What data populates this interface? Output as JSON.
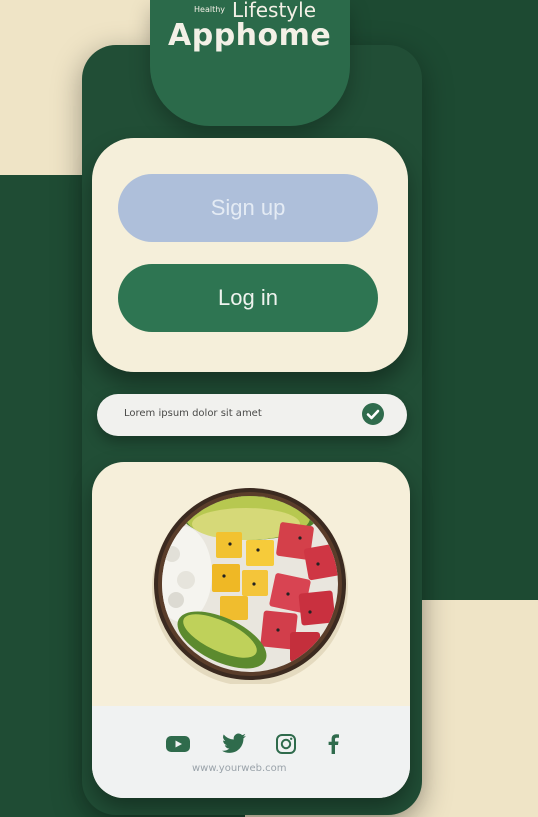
{
  "brand": {
    "small": "Healthy",
    "lifestyle": "Lifestyle",
    "name": "Apphome"
  },
  "auth": {
    "signup_label": "Sign up",
    "login_label": "Log in"
  },
  "checkbox": {
    "text": "Lorem ipsum dolor sit amet",
    "checked": true
  },
  "footer": {
    "social_icons": [
      "youtube-icon",
      "twitter-icon",
      "instagram-icon",
      "facebook-icon"
    ],
    "website": "www.yourweb.com"
  },
  "colors": {
    "primary_green": "#2e7552",
    "signup_blue": "#aebfda",
    "cream": "#f5efda"
  }
}
